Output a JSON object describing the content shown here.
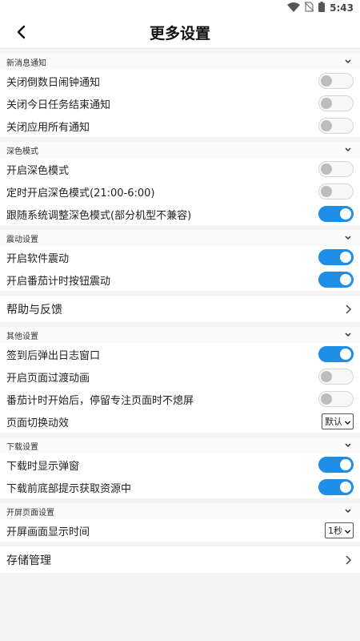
{
  "status_bar": {
    "time": "5:43",
    "icons": [
      "wifi-icon",
      "no-sim-icon",
      "battery-icon"
    ]
  },
  "header": {
    "title": "更多设置",
    "back_icon": "back-arrow-icon"
  },
  "sections": {
    "notify": {
      "title": "新消息通知",
      "items": [
        {
          "label": "关闭倒数日闹钟通知",
          "on": false
        },
        {
          "label": "关闭今日任务结束通知",
          "on": false
        },
        {
          "label": "关闭应用所有通知",
          "on": false
        }
      ]
    },
    "dark": {
      "title": "深色模式",
      "items": [
        {
          "label": "开启深色模式",
          "on": false
        },
        {
          "label": "定时开启深色模式(21:00-6:00)",
          "on": false
        },
        {
          "label": "跟随系统调整深色模式(部分机型不兼容)",
          "on": true
        }
      ]
    },
    "vibrate": {
      "title": "震动设置",
      "items": [
        {
          "label": "开启软件震动",
          "on": true
        },
        {
          "label": "开启番茄计时按钮震动",
          "on": true
        }
      ]
    },
    "help": {
      "label": "帮助与反馈"
    },
    "other": {
      "title": "其他设置",
      "items": [
        {
          "label": "签到后弹出日志窗口",
          "on": true
        },
        {
          "label": "开启页面过渡动画",
          "on": false
        },
        {
          "label": "番茄计时开始后，停留专注页面时不熄屏",
          "on": false
        }
      ],
      "select_row": {
        "label": "页面切换动效",
        "value": "默认"
      }
    },
    "download": {
      "title": "下载设置",
      "items": [
        {
          "label": "下载时显示弹窗",
          "on": true
        },
        {
          "label": "下载前底部提示获取资源中",
          "on": true
        }
      ]
    },
    "splash": {
      "title": "开屏页面设置",
      "select_row": {
        "label": "开屏画面显示时间",
        "value": "1秒"
      }
    },
    "storage": {
      "label": "存储管理"
    }
  },
  "colors": {
    "accent": "#1e8ee6",
    "background": "#f4f4f4"
  }
}
